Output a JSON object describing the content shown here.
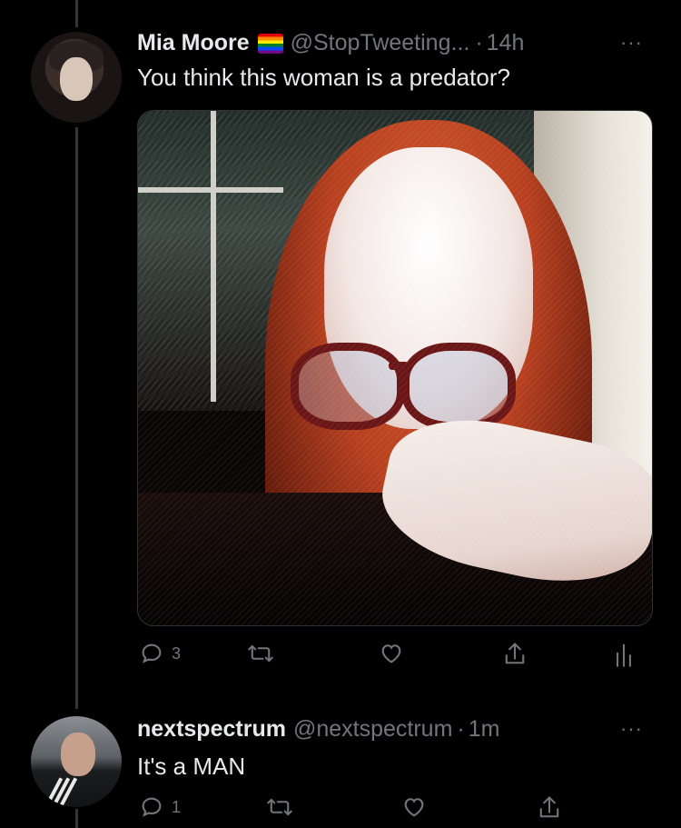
{
  "tweets": [
    {
      "name": "Mia Moore",
      "handle": "@StopTweeting...",
      "separator": "·",
      "time": "14h",
      "text": "You think this woman is a predator?",
      "reply_count": "3",
      "flag": "rainbow-flag-icon",
      "has_media": true
    },
    {
      "name": "nextspectrum",
      "handle": "@nextspectrum",
      "separator": "·",
      "time": "1m",
      "text": "It's a MAN",
      "reply_count": "1",
      "has_media": false
    }
  ],
  "more_label": "···",
  "colors": {
    "background": "#000000",
    "text": "#e7e9ea",
    "muted": "#71767b",
    "thread_line": "#333639"
  },
  "icons": [
    "reply-icon",
    "retweet-icon",
    "like-icon",
    "share-icon",
    "analytics-icon",
    "more-icon"
  ]
}
